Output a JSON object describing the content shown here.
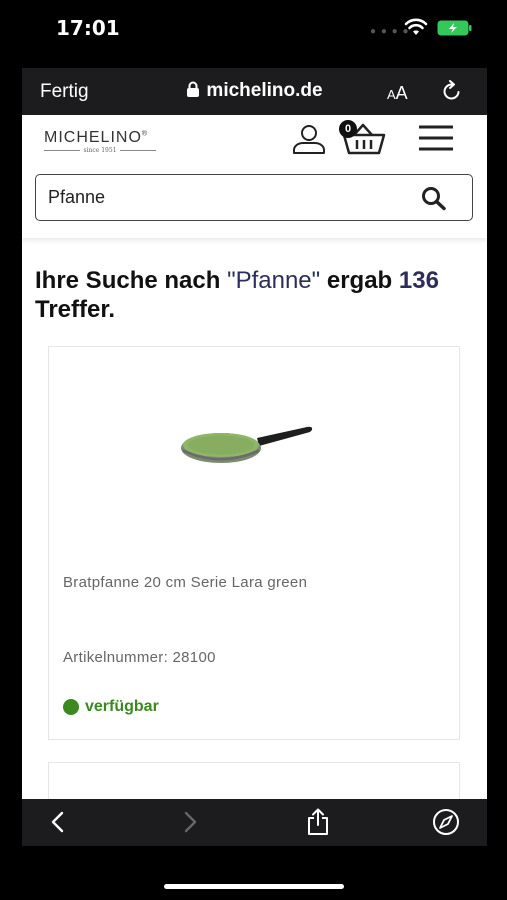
{
  "status_bar": {
    "time": "17:01"
  },
  "safari": {
    "done_label": "Fertig",
    "url": "michelino.de",
    "text_size_small": "A",
    "text_size_large": "A"
  },
  "site": {
    "logo_text": "MICHELINO",
    "logo_mark": "®",
    "logo_tagline": "since 1951",
    "cart_count": "0",
    "search_value": "Pfanne"
  },
  "results": {
    "heading_prefix": "Ihre Suche nach ",
    "search_term": "\"Pfanne\"",
    "heading_middle": " ergab ",
    "count": "136",
    "heading_suffix": " Treffer."
  },
  "products": [
    {
      "name": "Bratpfanne 20 cm Serie Lara green",
      "sku": "Artikelnummer: 28100",
      "availability": "verfügbar"
    }
  ],
  "colors": {
    "accent": "#2b2d5a",
    "available": "#3a8a1f",
    "safari_bar": "#1c1c1e",
    "battery": "#34c759"
  },
  "icons": [
    "wifi-icon",
    "battery-icon",
    "lock-icon",
    "reload-icon",
    "user-icon",
    "cart-icon",
    "menu-icon",
    "search-icon",
    "back-icon",
    "forward-icon",
    "share-icon",
    "compass-icon"
  ]
}
